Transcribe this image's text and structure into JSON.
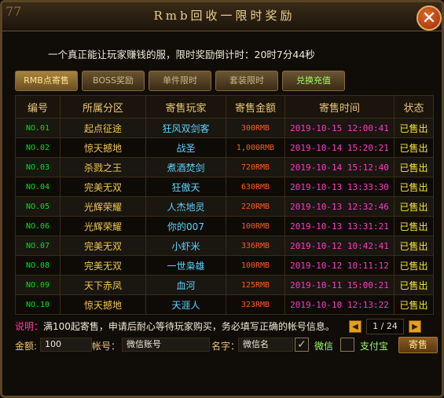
{
  "window": {
    "title": "Rmb回收一限时奖励",
    "corner_mark": "77"
  },
  "countdown_text": "一个真正能让玩家赚钱的服，限时奖励倒计时：20时7分44秒",
  "tabs": [
    {
      "label": "RMB点寄售",
      "active": true
    },
    {
      "label": "BOSS奖励",
      "active": false
    },
    {
      "label": "单件限时",
      "active": false
    },
    {
      "label": "套装限时",
      "active": false
    },
    {
      "label": "兑换充值",
      "active": false
    }
  ],
  "table": {
    "headers": [
      "编号",
      "所属分区",
      "寄售玩家",
      "寄售金额",
      "寄售时间",
      "状态"
    ],
    "rows": [
      {
        "no": "NO.01",
        "zone": "起点征途",
        "seller": "狂风双剑客",
        "amount": "300RMB",
        "time": "2019-10-15 12:00:41",
        "status": "已售出"
      },
      {
        "no": "NO.02",
        "zone": "惊天撼地",
        "seller": "战圣",
        "amount": "1,000RMB",
        "time": "2019-10-14 15:20:21",
        "status": "已售出"
      },
      {
        "no": "NO.03",
        "zone": "杀戮之王",
        "seller": "煮酒焚剑",
        "amount": "720RMB",
        "time": "2019-10-14 15:12:40",
        "status": "已售出"
      },
      {
        "no": "NO.04",
        "zone": "完美无双",
        "seller": "狂傲天",
        "amount": "630RMB",
        "time": "2019-10-13 13:33:30",
        "status": "已售出"
      },
      {
        "no": "NO.05",
        "zone": "光辉荣耀",
        "seller": "人杰地灵",
        "amount": "220RMB",
        "time": "2019-10-13 12:32:46",
        "status": "已售出"
      },
      {
        "no": "NO.06",
        "zone": "光辉荣耀",
        "seller": "你的007",
        "amount": "100RMB",
        "time": "2019-10-13 13:31:21",
        "status": "已售出"
      },
      {
        "no": "NO.07",
        "zone": "完美无双",
        "seller": "小虾米",
        "amount": "336RMB",
        "time": "2019-10-12 10:42:41",
        "status": "已售出"
      },
      {
        "no": "NO.08",
        "zone": "完美无双",
        "seller": "一世枭雄",
        "amount": "100RMB",
        "time": "2019-10-12 10:11:12",
        "status": "已售出"
      },
      {
        "no": "NO.09",
        "zone": "天下赤凤",
        "seller": "血河",
        "amount": "125RMB",
        "time": "2019-10-11 15:00:21",
        "status": "已售出"
      },
      {
        "no": "NO.10",
        "zone": "惊天撼地",
        "seller": "天涯人",
        "amount": "323RMB",
        "time": "2019-10-10 12:13:22",
        "status": "已售出"
      }
    ]
  },
  "note": {
    "label": "说明：",
    "text": "满100起寄售，申请后耐心等待玩家购买，务必填写正确的帐号信息。"
  },
  "pager": {
    "text": "1 / 24",
    "prev_glyph": "◀",
    "next_glyph": "▶"
  },
  "form": {
    "amount_label": "金额:",
    "amount_value": "100",
    "account_label": "帐号：",
    "account_value": "微信账号",
    "name_label": "名字：",
    "name_value": "微信名",
    "wechat_label": "微信",
    "wechat_checked": true,
    "alipay_label": "支付宝",
    "alipay_checked": false,
    "submit_label": "寄售"
  }
}
